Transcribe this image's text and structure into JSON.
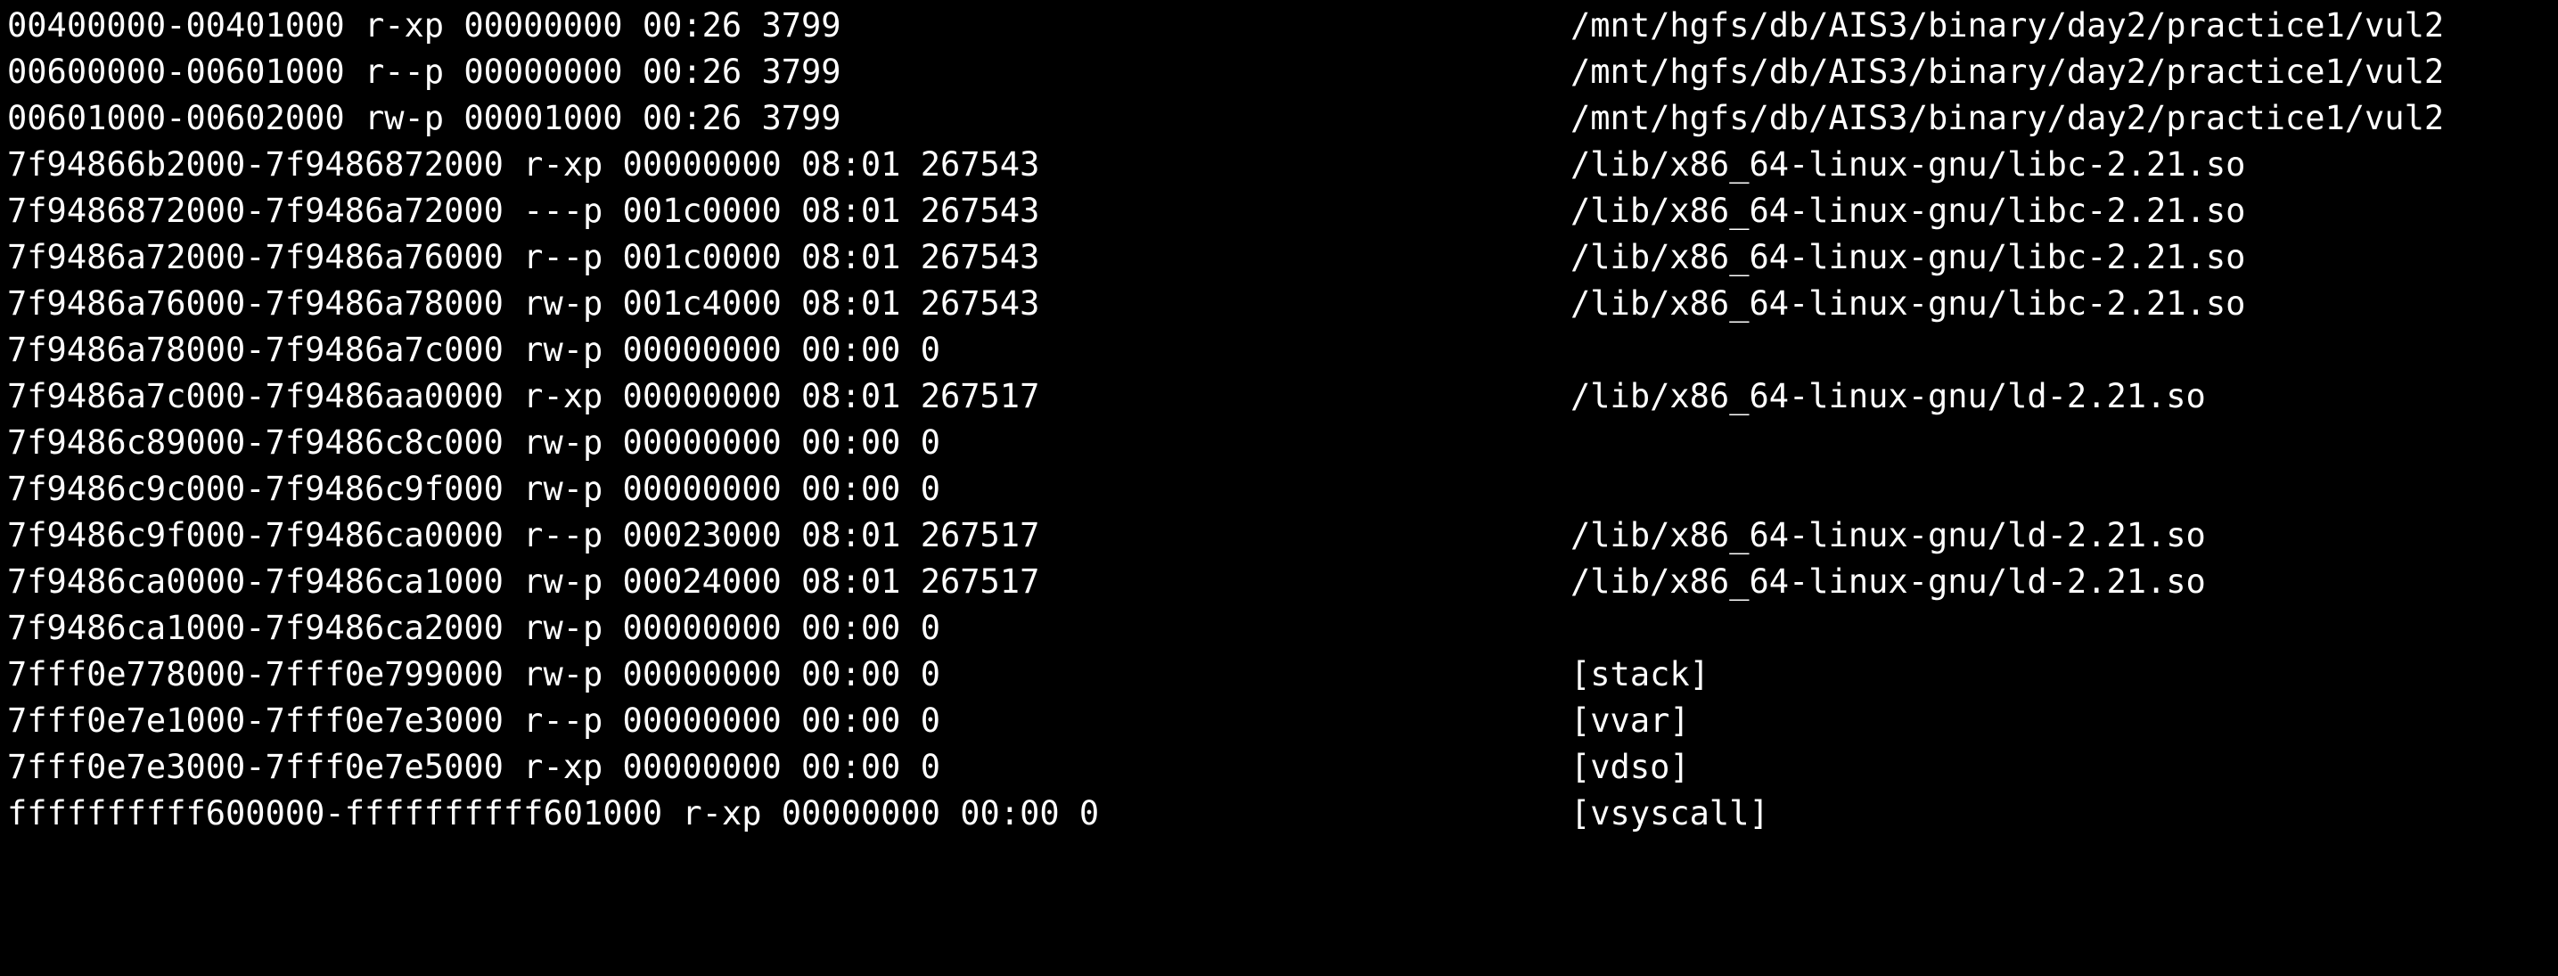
{
  "terminal": {
    "lines": [
      {
        "mapping": "00400000-00401000 r-xp 00000000 00:26 3799",
        "path": "/mnt/hgfs/db/AIS3/binary/day2/practice1/vul2"
      },
      {
        "mapping": "00600000-00601000 r--p 00000000 00:26 3799",
        "path": "/mnt/hgfs/db/AIS3/binary/day2/practice1/vul2"
      },
      {
        "mapping": "00601000-00602000 rw-p 00001000 00:26 3799",
        "path": "/mnt/hgfs/db/AIS3/binary/day2/practice1/vul2"
      },
      {
        "mapping": "7f94866b2000-7f9486872000 r-xp 00000000 08:01 267543",
        "path": "/lib/x86_64-linux-gnu/libc-2.21.so"
      },
      {
        "mapping": "7f9486872000-7f9486a72000 ---p 001c0000 08:01 267543",
        "path": "/lib/x86_64-linux-gnu/libc-2.21.so"
      },
      {
        "mapping": "7f9486a72000-7f9486a76000 r--p 001c0000 08:01 267543",
        "path": "/lib/x86_64-linux-gnu/libc-2.21.so"
      },
      {
        "mapping": "7f9486a76000-7f9486a78000 rw-p 001c4000 08:01 267543",
        "path": "/lib/x86_64-linux-gnu/libc-2.21.so"
      },
      {
        "mapping": "7f9486a78000-7f9486a7c000 rw-p 00000000 00:00 0",
        "path": ""
      },
      {
        "mapping": "7f9486a7c000-7f9486aa0000 r-xp 00000000 08:01 267517",
        "path": "/lib/x86_64-linux-gnu/ld-2.21.so"
      },
      {
        "mapping": "7f9486c89000-7f9486c8c000 rw-p 00000000 00:00 0",
        "path": ""
      },
      {
        "mapping": "7f9486c9c000-7f9486c9f000 rw-p 00000000 00:00 0",
        "path": ""
      },
      {
        "mapping": "7f9486c9f000-7f9486ca0000 r--p 00023000 08:01 267517",
        "path": "/lib/x86_64-linux-gnu/ld-2.21.so"
      },
      {
        "mapping": "7f9486ca0000-7f9486ca1000 rw-p 00024000 08:01 267517",
        "path": "/lib/x86_64-linux-gnu/ld-2.21.so"
      },
      {
        "mapping": "7f9486ca1000-7f9486ca2000 rw-p 00000000 00:00 0",
        "path": ""
      },
      {
        "mapping": "7fff0e778000-7fff0e799000 rw-p 00000000 00:00 0",
        "path": "[stack]"
      },
      {
        "mapping": "7fff0e7e1000-7fff0e7e3000 r--p 00000000 00:00 0",
        "path": "[vvar]"
      },
      {
        "mapping": "7fff0e7e3000-7fff0e7e5000 r-xp 00000000 00:00 0",
        "path": "[vdso]"
      },
      {
        "mapping": "ffffffffff600000-ffffffffff601000 r-xp 00000000 00:00 0",
        "path": "[vsyscall]"
      }
    ],
    "colors": {
      "background": "#000000",
      "foreground": "#ffffff"
    }
  }
}
